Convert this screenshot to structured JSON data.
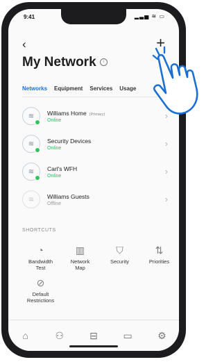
{
  "status": {
    "time": "9:41",
    "icons": "▂▃▅ ≋ ▭"
  },
  "header": {
    "back": "‹",
    "add": "+",
    "title": "My Network",
    "info_icon": "info-icon"
  },
  "tabs": [
    {
      "label": "Networks",
      "active": true
    },
    {
      "label": "Equipment",
      "active": false
    },
    {
      "label": "Services",
      "active": false
    },
    {
      "label": "Usage",
      "active": false
    }
  ],
  "networks": [
    {
      "name": "Williams Home",
      "tag": "(Primary)",
      "status": "Online",
      "state": "online"
    },
    {
      "name": "Security Devices",
      "tag": "",
      "status": "Online",
      "state": "online"
    },
    {
      "name": "Carl's WFH",
      "tag": "",
      "status": "Online",
      "state": "online"
    },
    {
      "name": "Williams Guests",
      "tag": "",
      "status": "Offline",
      "state": "offline"
    }
  ],
  "shortcuts": {
    "heading": "SHORTCUTS",
    "items": [
      {
        "label": "Bandwidth\nTest",
        "icon": "speedometer-icon"
      },
      {
        "label": "Network\nMap",
        "icon": "map-icon"
      },
      {
        "label": "Security",
        "icon": "shield-icon"
      },
      {
        "label": "Priorities",
        "icon": "priority-list-icon"
      },
      {
        "label": "Default\nRestrictions",
        "icon": "restrictions-icon"
      }
    ]
  },
  "bottom_nav": [
    "home-icon",
    "people-icon",
    "router-icon",
    "monitor-icon",
    "gear-icon"
  ],
  "colors": {
    "accent": "#1a6fd1",
    "online": "#39b55a",
    "offline": "#9a9a9a"
  }
}
